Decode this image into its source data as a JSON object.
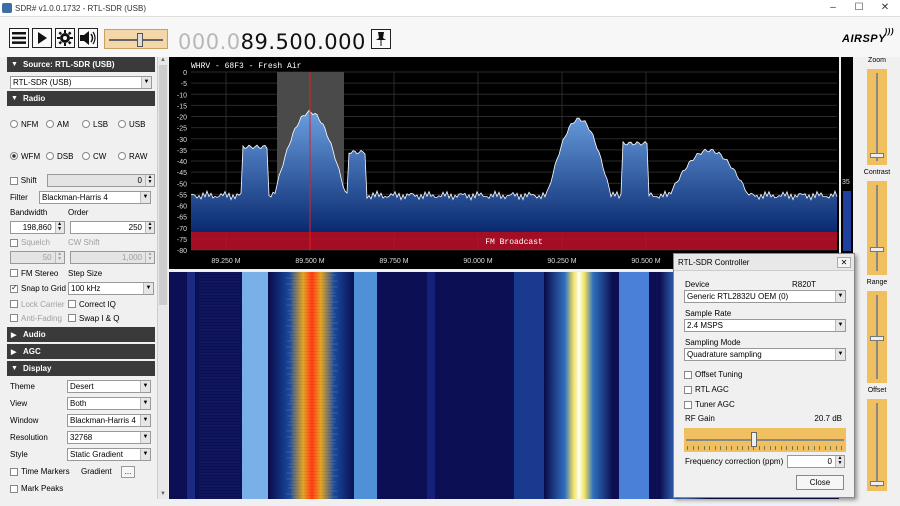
{
  "window": {
    "title": "SDR# v1.0.0.1732 - RTL-SDR (USB)",
    "min": "–",
    "max": "☐",
    "close": "✕"
  },
  "toolbar": {
    "freq_dim": "000.0",
    "freq_active": "89.500.000",
    "logo": "AIRSPY",
    "volume_level": 0.55
  },
  "sidebar": {
    "source": {
      "header": "Source: RTL-SDR (USB)",
      "device": "RTL-SDR (USB)"
    },
    "radio": {
      "header": "Radio",
      "modes": [
        "NFM",
        "AM",
        "LSB",
        "USB",
        "WFM",
        "DSB",
        "CW",
        "RAW"
      ],
      "selected": "WFM",
      "shift_label": "Shift",
      "shift_value": "0",
      "filter_label": "Filter",
      "filter_value": "Blackman-Harris 4",
      "bandwidth_label": "Bandwidth",
      "bandwidth_value": "198,860",
      "order_label": "Order",
      "order_value": "250",
      "squelch_label": "Squelch",
      "squelch_value": "50",
      "cwshift_label": "CW Shift",
      "cwshift_value": "1,000",
      "fmstereo_label": "FM Stereo",
      "stepsize_label": "Step Size",
      "snap_label": "Snap to Grid",
      "snap_value": "100 kHz",
      "lockcarrier_label": "Lock Carrier",
      "correctiq_label": "Correct IQ",
      "antifading_label": "Anti-Fading",
      "swapiq_label": "Swap I & Q"
    },
    "audio": {
      "header": "Audio"
    },
    "agc": {
      "header": "AGC"
    },
    "display": {
      "header": "Display",
      "theme_label": "Theme",
      "theme_value": "Desert",
      "view_label": "View",
      "view_value": "Both",
      "window_label": "Window",
      "window_value": "Blackman-Harris 4",
      "resolution_label": "Resolution",
      "resolution_value": "32768",
      "style_label": "Style",
      "style_value": "Static Gradient",
      "timemarkers_label": "Time Markers",
      "gradient_label": "Gradient",
      "gradient_btn": "...",
      "markpeaks_label": "Mark Peaks"
    }
  },
  "spectrum": {
    "station": "WHRV      - 68F3 - Fresh Air",
    "band_label": "FM Broadcast",
    "db_ticks": [
      "0",
      "-5",
      "-10",
      "-15",
      "-20",
      "-25",
      "-30",
      "-35",
      "-40",
      "-45",
      "-50",
      "-55",
      "-60",
      "-65",
      "-70",
      "-75",
      "-80"
    ],
    "freq_ticks": [
      "89.250 M",
      "89.500 M",
      "89.750 M",
      "90.000 M",
      "90.250 M",
      "90.500 M"
    ],
    "level_value": "35"
  },
  "right_controls": {
    "zoom": "Zoom",
    "contrast": "Contrast",
    "range": "Range",
    "offset": "Offset"
  },
  "rtl_dialog": {
    "title": "RTL-SDR Controller",
    "device_label": "Device",
    "tuner": "R820T",
    "device_value": "Generic RTL2832U OEM (0)",
    "samplerate_label": "Sample Rate",
    "samplerate_value": "2.4 MSPS",
    "samplingmode_label": "Sampling Mode",
    "samplingmode_value": "Quadrature sampling",
    "offset_tuning": "Offset Tuning",
    "rtl_agc": "RTL AGC",
    "tuner_agc": "Tuner AGC",
    "rfgain_label": "RF Gain",
    "rfgain_value": "20.7 dB",
    "freqcorr_label": "Frequency correction (ppm)",
    "freqcorr_value": "0",
    "close_btn": "Close"
  },
  "colors": {
    "spectrum_fill": "#1e4fa0",
    "band_red": "#c0102a",
    "slider_gold": "#f0c060"
  }
}
